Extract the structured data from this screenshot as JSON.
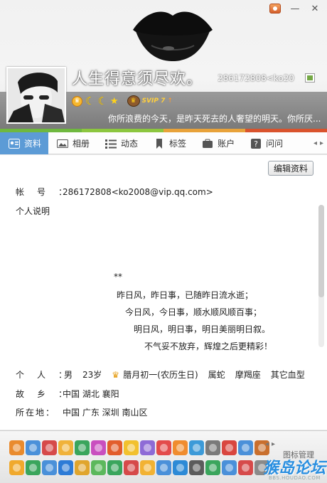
{
  "window": {
    "skin_icon": "skin-icon",
    "min_icon": "minimize-icon",
    "close_icon": "close-icon",
    "min_glyph": "—",
    "close_glyph": "✕"
  },
  "profile": {
    "nickname": "人生得意须尽欢。",
    "qq_display": "286172808<ko20",
    "vip_label": "SVIP 7",
    "vip_up": "↑",
    "signature": "你所浪费的今天，是昨天死去的人奢望的明天。你所厌..."
  },
  "tabs": [
    {
      "label": "资料",
      "icon": "profile-card-icon"
    },
    {
      "label": "相册",
      "icon": "photo-album-icon"
    },
    {
      "label": "动态",
      "icon": "feed-list-icon"
    },
    {
      "label": "标签",
      "icon": "bookmark-tag-icon"
    },
    {
      "label": "账户",
      "icon": "wallet-icon"
    },
    {
      "label": "问问",
      "icon": "question-icon"
    }
  ],
  "tab_more": {
    "left": "◂",
    "right": "▸"
  },
  "content": {
    "edit_button": "编辑资料",
    "account_label": "帐号：",
    "account_value": "286172808<ko2008@vip.qq.com>",
    "desc_label": "个人说明",
    "poem": [
      "**",
      "昨日风，昨日事，已随昨日流水逝；",
      "今日风，今日事，顺水顺风顺百事；",
      "明日风，明日事，明日美丽明日叙。",
      "不气妥不放弃，辉煌之后更精彩！"
    ],
    "personal_label": "个人：",
    "personal_values": [
      "男",
      "23岁",
      "腊月初一(农历生日)",
      "属蛇",
      "摩羯座",
      "其它血型"
    ],
    "hometown_label": "故乡：",
    "hometown_value": "中国 湖北 襄阳",
    "location_label": "所在地：",
    "location_value": "中国 广东 深圳 南山区"
  },
  "iconbar": {
    "manage_label": "图标管理",
    "nav_left": "◂",
    "nav_right": "▸",
    "row1_colors": [
      "#e98b2e",
      "#4a90d9",
      "#d64a4a",
      "#f0b23a",
      "#3aa55c",
      "#c94fbf",
      "#e25d2c",
      "#f2c12e",
      "#8e6bd6",
      "#e34b4b",
      "#f08c2e",
      "#3c9ad8",
      "#7a7a7a",
      "#d9463f",
      "#4a90d9",
      "#c96f2d"
    ],
    "row2_colors": [
      "#f0a92d",
      "#3aa55c",
      "#4a90d9",
      "#2d7bd6",
      "#e0a52d",
      "#5cb85c",
      "#3aa55c",
      "#d64a4a",
      "#f2b233",
      "#4a90d9",
      "#2d8ad6",
      "#5c5c5c",
      "#3aa55c",
      "#4a90d9",
      "#d64a4a",
      "#8a8a8a"
    ]
  },
  "watermark": {
    "text": "猴岛论坛",
    "sub": "BBS.HOUDAO.COM"
  },
  "colors": {
    "accent_tab": "#5c9bd6",
    "strip": [
      "#6fb83f",
      "#8cc63f",
      "#e8a23a",
      "#d9532d"
    ]
  }
}
